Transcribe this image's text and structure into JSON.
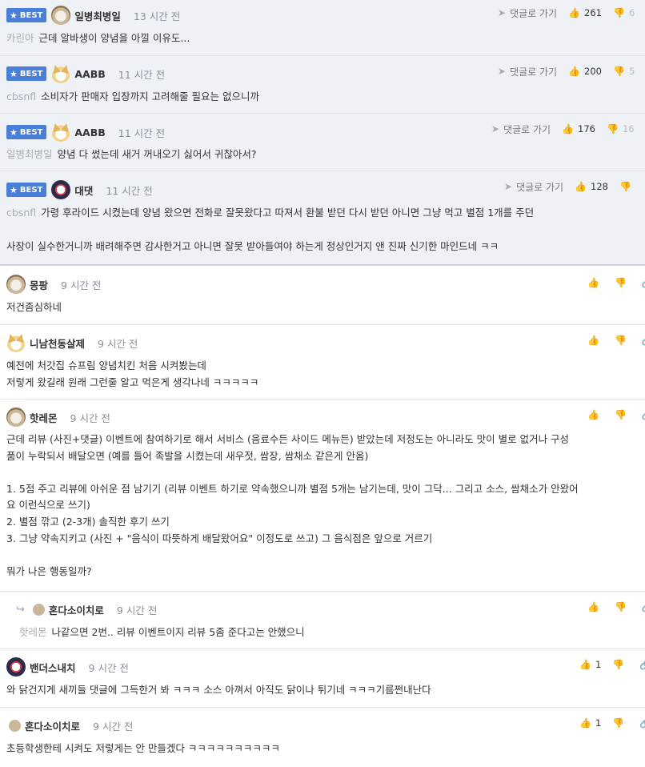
{
  "labels": {
    "best": "BEST",
    "goto_comment": "댓글로 가기"
  },
  "icons": {
    "star": "★",
    "goto": "➤",
    "thumb_up": "👍",
    "thumb_down": "👎",
    "link": "🔗",
    "reply_arrow": "↪"
  },
  "best_comments": [
    {
      "author": "일병최병일",
      "time": "13 시간 전",
      "up": "261",
      "down": "6",
      "mention": "카린아",
      "text": "근데 알바생이 양념을 아낄 이유도..."
    },
    {
      "author": "AABB",
      "time": "11 시간 전",
      "up": "200",
      "down": "5",
      "mention": "cbsnfl",
      "text": "소비자가 판매자 입장까지 고려해줄 필요는 없으니까"
    },
    {
      "author": "AABB",
      "time": "11 시간 전",
      "up": "176",
      "down": "16",
      "mention": "일병최병일",
      "text": "양념 다 썼는데 새거 꺼내오기 싫어서 귀찮아서?"
    },
    {
      "author": "대댓",
      "time": "11 시간 전",
      "up": "128",
      "down": "",
      "mention": "cbsnfl",
      "text": "가령 후라이드 시켰는데 양념 왔으면 전화로 잘못왔다고 따져서 환불 받던 다시 받던 아니면 그냥 먹고 별점 1개를 주던",
      "text2": "사장이 실수한거니까 배려해주면 감사한거고 아니면 잘못 받아들여야 하는게 정상인거지 앤 진짜 신기한 마인드네 ㅋㅋ"
    }
  ],
  "comments": [
    {
      "author": "몽팡",
      "time": "9 시간 전",
      "lines": [
        "저건좀심하네"
      ]
    },
    {
      "author": "니남천동살제",
      "time": "9 시간 전",
      "lines": [
        "예전에 처갓집 슈프림 양념치킨 처음 시켜봤는데",
        "저렇게 왔길래 원래 그런줄 알고 먹은게 생각나네 ㅋㅋㅋㅋㅋ"
      ]
    },
    {
      "author": "핫레몬",
      "time": "9 시간 전",
      "lines": [
        "근데 리뷰 (사진+댓글) 이벤트에 참여하기로 해서 서비스 (음료수든 사이드 메뉴든) 받았는데 저정도는 아니라도 맛이 별로 없거나 구성",
        "품이 누락되서 배달오면 (예를 들어 족발을 시켰는데 새우젓, 쌈장, 쌈채소 같은게 안옴)",
        "",
        "1. 5점 주고 리뷰에 아쉬운 점 남기기 (리뷰 이벤트 하기로 약속했으니까 별점 5개는 남기는데, 맛이 그닥... 그리고 소스, 쌈채소가 안왔어",
        "요 이런식으로 쓰기)",
        "2. 별점 깎고 (2-3개) 솔직한 후기 쓰기",
        "3. 그냥 약속지키고 (사진 + \"음식이 따뜻하게 배달왔어요\" 이정도로 쓰고) 그 음식점은 앞으로 거르기",
        "",
        "뭐가 나은 행동일까?"
      ]
    },
    {
      "author": "혼다소이치로",
      "time": "9 시간 전",
      "mention": "핫레몬",
      "text": "나같으면 2번.. 리뷰 이벤트이지 리뷰 5좀 준다고는 안했으니"
    },
    {
      "author": "밴더스내치",
      "time": "9 시간 전",
      "up": "1",
      "lines": [
        "와 닭건지게 새끼들 댓글에 그득한거 봐 ㅋㅋㅋ 소스 아껴서 아직도 닭이나 튀기네 ㅋㅋㅋ기름쩐내난다"
      ]
    },
    {
      "author": "혼다소이치로",
      "time": "9 시간 전",
      "up": "1",
      "lines": [
        "초등학생한테 시켜도 저렇게는 안 만들겠다 ㅋㅋㅋㅋㅋㅋㅋㅋㅋㅋ"
      ]
    }
  ]
}
